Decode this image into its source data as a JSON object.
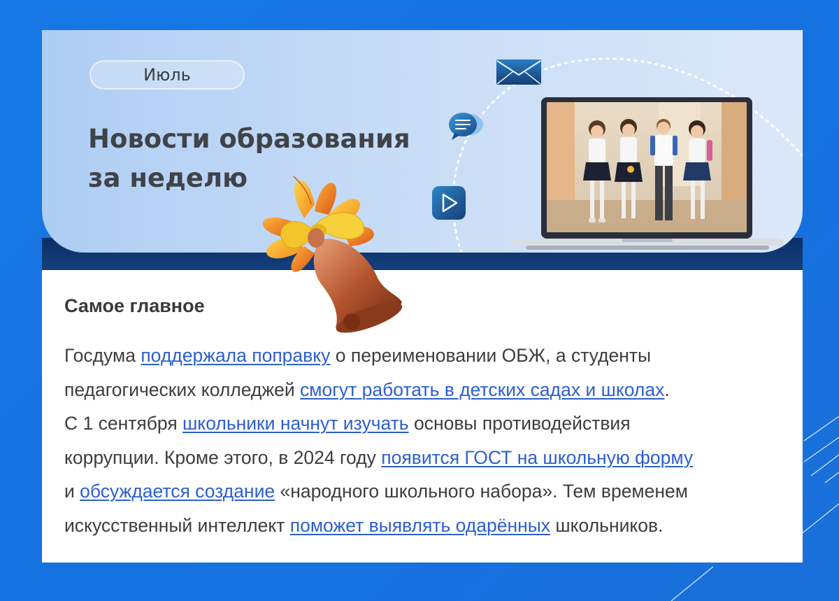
{
  "header": {
    "month": "Июль",
    "title_line1": "Новости образования",
    "title_line2": "за неделю"
  },
  "icons": [
    "envelope-icon",
    "chat-bubble-icon",
    "play-icon",
    "school-bell-icon",
    "autumn-leaves-icon"
  ],
  "colors": {
    "page_background": "#1677e5",
    "header_gradient_start": "#aecdf4",
    "header_gradient_end": "#dbe8f8",
    "title_text": "#404348",
    "link": "#2c5fcf",
    "body_text": "#3d3d3d"
  },
  "content": {
    "section_title": "Самое главное",
    "paragraph": {
      "s1_pre": "Госдума ",
      "s1_link": "поддержала поправку",
      "s1_post": " о переименовании ОБЖ, а студенты",
      "s2_pre": "педагогических колледжей ",
      "s2_link": "смогут работать в детских садах и школах",
      "s2_post": ".",
      "s3_pre": "С 1 сентября ",
      "s3_link": "школьники начнут изучать",
      "s3_post": " основы противодействия",
      "s4_pre": "коррупции. Кроме этого, в 2024 году ",
      "s4_link": "появится ГОСТ на школьную форму",
      "s5_pre": "и ",
      "s5_link": "обсуждается создание",
      "s5_post": " «народного школьного набора». Тем временем",
      "s6_pre": "искусственный интеллект ",
      "s6_link": "поможет выявлять одарённых",
      "s6_post": " школьников."
    }
  }
}
